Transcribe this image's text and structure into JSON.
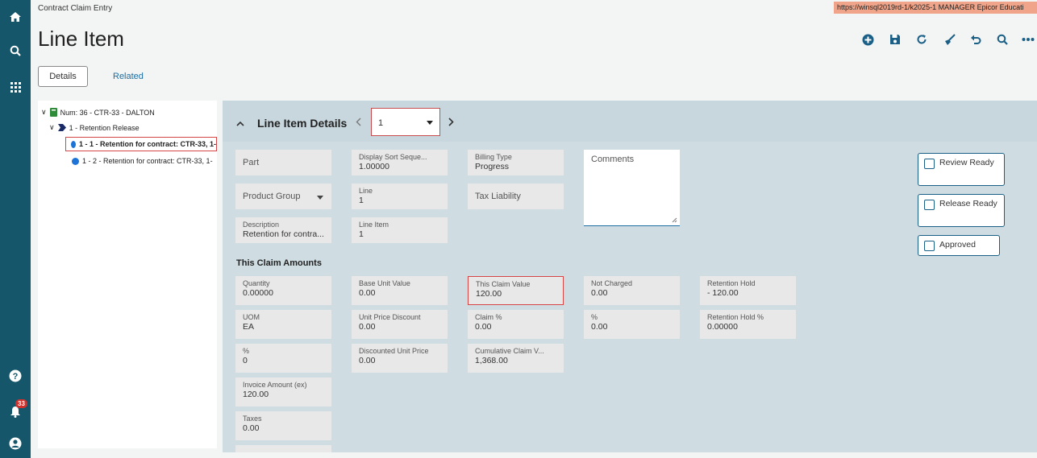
{
  "app": {
    "breadcrumb": "Contract Claim Entry",
    "title": "Line Item",
    "server": "https://winsql2019rd-1/k2025-1   MANAGER   Epicor Educati",
    "notifications_count": "33"
  },
  "tabs": {
    "details": "Details",
    "related": "Related"
  },
  "tree": {
    "root": "Num: 36 - CTR-33 - DALTON",
    "child": "1 - Retention Release",
    "items": [
      "1 - 1 - Retention for contract: CTR-33, 1-",
      "1 - 2 - Retention for contract: CTR-33, 1-"
    ]
  },
  "panel": {
    "title": "Line Item Details",
    "selected_line": "1",
    "section_title": "This Claim Amounts"
  },
  "fields": {
    "part": "Part",
    "display_sort_label": "Display Sort Seque...",
    "display_sort_value": "1.00000",
    "billing_type_label": "Billing Type",
    "billing_type_value": "Progress",
    "comments": "Comments",
    "product_group": "Product Group",
    "line_label": "Line",
    "line_value": "1",
    "tax_liability": "Tax Liability",
    "description_label": "Description",
    "description_value": "Retention for contra...",
    "line_item_label": "Line Item",
    "line_item_value": "1",
    "quantity_label": "Quantity",
    "quantity_value": "0.00000",
    "base_unit_label": "Base Unit Value",
    "base_unit_value": "0.00",
    "this_claim_label": "This Claim Value",
    "this_claim_value": "120.00",
    "not_charged_label": "Not Charged",
    "not_charged_value": "0.00",
    "retention_hold_label": "Retention Hold",
    "retention_hold_value": "- 120.00",
    "uom_label": "UOM",
    "uom_value": "EA",
    "unit_price_disc_label": "Unit Price Discount",
    "unit_price_disc_value": "0.00",
    "claim_pct_label": "Claim %",
    "claim_pct_value": "0.00",
    "pct_label": "%",
    "pct_value": "0.00",
    "retention_hold_pct_label": "Retention Hold %",
    "retention_hold_pct_value": "0.00000",
    "pct2_label": "%",
    "pct2_value": "0",
    "disc_unit_price_label": "Discounted Unit Price",
    "disc_unit_price_value": "0.00",
    "cum_claim_label": "Cumulative Claim V...",
    "cum_claim_value": "1,368.00",
    "invoice_amt_label": "Invoice Amount (ex)",
    "invoice_amt_value": "120.00",
    "taxes_label": "Taxes",
    "taxes_value": "0.00"
  },
  "checkboxes": {
    "review_ready": "Review Ready",
    "release_ready": "Release Ready",
    "approved": "Approved"
  },
  "icons": [
    "home-icon",
    "search-icon",
    "apps-grid-icon",
    "help-icon",
    "bell-icon",
    "user-icon",
    "add-icon",
    "save-icon",
    "refresh-icon",
    "clear-icon",
    "undo-icon",
    "search-icon",
    "more-icon"
  ],
  "colors": {
    "nav": "#15566a",
    "accent": "#1a5f86",
    "highlight": "#d64545",
    "server_bar": "#f0a58a"
  }
}
